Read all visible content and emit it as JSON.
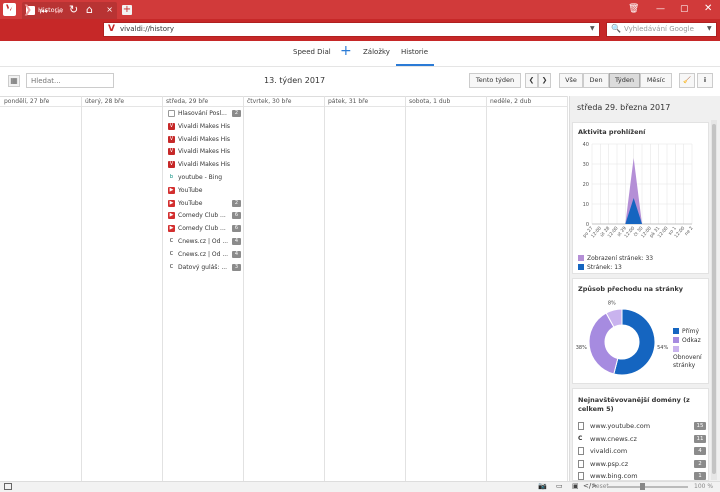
{
  "window": {
    "tab_title": "Historie",
    "new_tab_icon": "plus-icon",
    "icons": [
      "vivaldi-logo",
      "trash-icon",
      "minimize-icon",
      "maximize-icon",
      "close-icon"
    ]
  },
  "nav": {
    "url": "vivaldi://history",
    "search_placeholder": "Vyhledávání Google"
  },
  "panel_tabs": {
    "speed_dial": "Speed Dial",
    "bookmarks": "Záložky",
    "history": "Historie",
    "active": "history"
  },
  "toolbar": {
    "search_placeholder": "Hledat...",
    "week_title": "13. týden 2017",
    "this_week": "Tento týden",
    "views": [
      "Vše",
      "Den",
      "Týden",
      "Měsíc"
    ],
    "active_view": "Týden"
  },
  "calendar": {
    "days": [
      "pondělí, 27 bře",
      "úterý, 28 bře",
      "středa, 29 bře",
      "čtvrtek, 30 bře",
      "pátek, 31 bře",
      "sobota, 1 dub",
      "neděle, 2 dub"
    ],
    "entries": [
      {
        "title": "Hlasování Posl...",
        "count": "2",
        "icon": "page-icon"
      },
      {
        "title": "Vivaldi Makes His...",
        "count": "",
        "icon": "vivaldi-icon"
      },
      {
        "title": "Vivaldi Makes His...",
        "count": "",
        "icon": "vivaldi-icon"
      },
      {
        "title": "Vivaldi Makes His...",
        "count": "",
        "icon": "vivaldi-icon"
      },
      {
        "title": "Vivaldi Makes His...",
        "count": "",
        "icon": "vivaldi-icon"
      },
      {
        "title": "youtube - Bing",
        "count": "",
        "icon": "bing-icon"
      },
      {
        "title": "YouTube",
        "count": "",
        "icon": "youtube-icon"
      },
      {
        "title": "YouTube",
        "count": "2",
        "icon": "youtube-icon"
      },
      {
        "title": "Comedy Club ...",
        "count": "6",
        "icon": "youtube-icon"
      },
      {
        "title": "Comedy Club ...",
        "count": "6",
        "icon": "youtube-icon"
      },
      {
        "title": "Cnews.cz | Od ...",
        "count": "4",
        "icon": "cnews-icon"
      },
      {
        "title": "Cnews.cz | Od ...",
        "count": "4",
        "icon": "cnews-icon"
      },
      {
        "title": "Datový guláš: ...",
        "count": "3",
        "icon": "cnews-icon"
      }
    ]
  },
  "sidebar": {
    "date": "středa 29. března 2017",
    "activity": {
      "title": "Aktivita prohlížení",
      "legend_pages": "Zobrazení stránek: 33",
      "legend_sites": "Stránek: 13"
    },
    "transition": {
      "title": "Způsob přechodu na stránky",
      "legend": [
        "Přímý",
        "Odkaz",
        "Obnovení stránky"
      ]
    },
    "top_domains": {
      "title": "Nejnavštěvovanější domény (z celkem 5)",
      "items": [
        {
          "domain": "www.youtube.com",
          "count": "15",
          "icon": "page-icon"
        },
        {
          "domain": "www.cnews.cz",
          "count": "11",
          "icon": "cnews-icon"
        },
        {
          "domain": "vivaldi.com",
          "count": "4",
          "icon": "page-icon"
        },
        {
          "domain": "www.psp.cz",
          "count": "2",
          "icon": "page-icon"
        },
        {
          "domain": "www.bing.com",
          "count": "1",
          "icon": "page-icon"
        }
      ]
    }
  },
  "status": {
    "reset": "Reset",
    "zoom": "100 %"
  },
  "chart_data": [
    {
      "type": "area",
      "title": "Aktivita prohlížení",
      "x": [
        "po 27",
        "12:00",
        "út 28",
        "12:00",
        "st 29",
        "12:00",
        "čt 30",
        "12:00",
        "pá 31",
        "12:00",
        "so 1",
        "12:00",
        "ne 2"
      ],
      "yticks": [
        0,
        10,
        20,
        30,
        40
      ],
      "ylim": [
        0,
        40
      ],
      "series": [
        {
          "name": "Zobrazení stránek",
          "color": "#b48fd6",
          "values": [
            0,
            0,
            0,
            0,
            0,
            33,
            0,
            0,
            0,
            0,
            0,
            0,
            0
          ]
        },
        {
          "name": "Stránek",
          "color": "#1565c0",
          "values": [
            0,
            0,
            0,
            0,
            0,
            13,
            0,
            0,
            0,
            0,
            0,
            0,
            0
          ]
        }
      ]
    },
    {
      "type": "pie",
      "title": "Způsob přechodu na stránky",
      "categories": [
        "Přímý",
        "Odkaz",
        "Obnovení stránky"
      ],
      "values": [
        54,
        38,
        8
      ],
      "labels": [
        "54%",
        "38%",
        "8%"
      ],
      "colors": [
        "#1565c0",
        "#a68be0",
        "#c9b3ee"
      ]
    }
  ]
}
